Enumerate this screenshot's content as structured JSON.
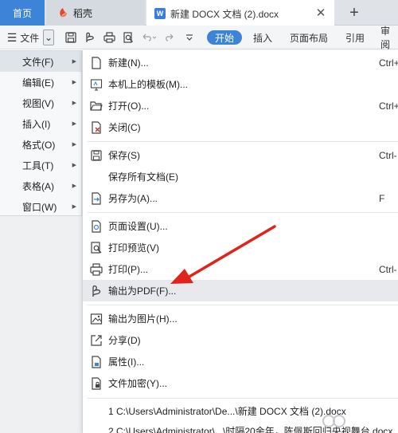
{
  "tabs": {
    "home": "首页",
    "daoke": "稻壳",
    "document": "新建 DOCX 文档 (2).docx",
    "doc_icon_letter": "W",
    "close_glyph": "✕",
    "add_glyph": "+"
  },
  "toolbar": {
    "file_label": "文件",
    "menu_glyph": "☰",
    "dropdown_glyph": "⌄",
    "icons": [
      "save-icon",
      "export-pdf-icon",
      "print-icon",
      "undo-icon",
      "redo-icon",
      "more-icon"
    ],
    "ribbon": [
      "开始",
      "插入",
      "页面布局",
      "引用",
      "审阅"
    ]
  },
  "left_menu": [
    {
      "label": "文件(F)",
      "active": true
    },
    {
      "label": "编辑(E)",
      "active": false
    },
    {
      "label": "视图(V)",
      "active": false
    },
    {
      "label": "插入(I)",
      "active": false
    },
    {
      "label": "格式(O)",
      "active": false
    },
    {
      "label": "工具(T)",
      "active": false
    },
    {
      "label": "表格(A)",
      "active": false
    },
    {
      "label": "窗口(W)",
      "active": false
    }
  ],
  "left_menu_arrow": "▶",
  "file_menu": {
    "items": [
      {
        "label": "新建(N)...",
        "shortcut": "Ctrl+",
        "icon": "new-doc-icon"
      },
      {
        "label": "本机上的模板(M)...",
        "shortcut": "",
        "icon": "template-icon"
      },
      {
        "label": "打开(O)...",
        "shortcut": "Ctrl+",
        "icon": "open-folder-icon"
      },
      {
        "label": "关闭(C)",
        "shortcut": "",
        "icon": "close-doc-icon"
      },
      {
        "label": "保存(S)",
        "shortcut": "Ctrl-",
        "icon": "save-icon"
      },
      {
        "label": "保存所有文档(E)",
        "shortcut": "",
        "icon": ""
      },
      {
        "label": "另存为(A)...",
        "shortcut": "F",
        "icon": "save-as-icon"
      },
      {
        "label": "页面设置(U)...",
        "shortcut": "",
        "icon": "page-setup-icon"
      },
      {
        "label": "打印预览(V)",
        "shortcut": "",
        "icon": "print-preview-icon"
      },
      {
        "label": "打印(P)...",
        "shortcut": "Ctrl-",
        "icon": "print-icon"
      },
      {
        "label": "输出为PDF(F)...",
        "shortcut": "",
        "icon": "export-pdf-icon"
      },
      {
        "label": "输出为图片(H)...",
        "shortcut": "",
        "icon": "export-image-icon"
      },
      {
        "label": "分享(D)",
        "shortcut": "",
        "icon": "share-icon"
      },
      {
        "label": "属性(I)...",
        "shortcut": "",
        "icon": "properties-icon"
      },
      {
        "label": "文件加密(Y)...",
        "shortcut": "",
        "icon": "encrypt-icon"
      }
    ],
    "recent": [
      "1 C:\\Users\\Administrator\\De...\\新建 DOCX 文档 (2).docx",
      "2 C:\\Users\\Administrator\\...\\时隔20余年，陈佩斯回归央视舞台.docx"
    ]
  }
}
